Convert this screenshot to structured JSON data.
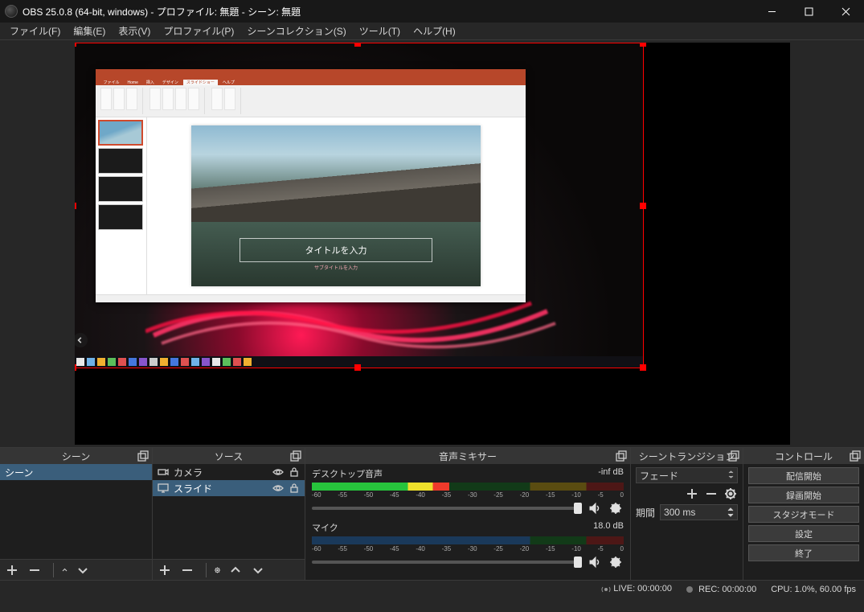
{
  "titlebar": {
    "title": "OBS 25.0.8 (64-bit, windows) - プロファイル: 無題 - シーン: 無題"
  },
  "menu": {
    "file": "ファイル(F)",
    "edit": "編集(E)",
    "view": "表示(V)",
    "profile": "プロファイル(P)",
    "scene_collection": "シーンコレクション(S)",
    "tools": "ツール(T)",
    "help": "ヘルプ(H)"
  },
  "preview": {
    "ppt_slide_title": "タイトルを入力",
    "ppt_slide_subtitle": "サブタイトルを入力"
  },
  "docks": {
    "scenes": {
      "title": "シーン",
      "items": [
        "シーン"
      ]
    },
    "sources": {
      "title": "ソース",
      "items": [
        {
          "icon": "camera",
          "label": "カメラ",
          "visible": true,
          "locked": false
        },
        {
          "icon": "monitor",
          "label": "スライド",
          "visible": true,
          "locked": false
        }
      ]
    },
    "mixer": {
      "title": "音声ミキサー",
      "ticks": [
        "-60",
        "-55",
        "-50",
        "-45",
        "-40",
        "-35",
        "-30",
        "-25",
        "-20",
        "-15",
        "-10",
        "-5",
        "0"
      ],
      "channels": [
        {
          "name": "デスクトップ音声",
          "db": "-inf dB"
        },
        {
          "name": "マイク",
          "db": "18.0 dB"
        }
      ]
    },
    "transitions": {
      "title": "シーントランジション",
      "selected": "フェード",
      "duration_label": "期間",
      "duration_value": "300 ms"
    },
    "controls": {
      "title": "コントロール",
      "buttons": {
        "start_stream": "配信開始",
        "start_record": "録画開始",
        "studio_mode": "スタジオモード",
        "settings": "設定",
        "exit": "終了"
      }
    }
  },
  "statusbar": {
    "live": "LIVE: 00:00:00",
    "rec": "REC: 00:00:00",
    "cpu": "CPU: 1.0%, 60.00 fps"
  }
}
